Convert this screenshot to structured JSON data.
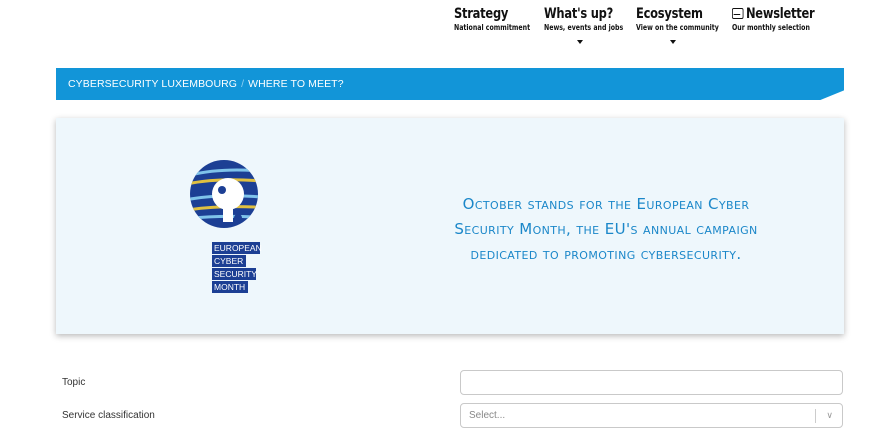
{
  "nav": {
    "items": [
      {
        "title": "Strategy",
        "subtitle": "National commitment"
      },
      {
        "title": "What's up?",
        "subtitle": "News, events and jobs"
      },
      {
        "title": "Ecosystem",
        "subtitle": "View on the community"
      },
      {
        "title": "Newsletter",
        "subtitle": "Our monthly selection"
      }
    ]
  },
  "breadcrumb": {
    "root": "CYBERSECURITY LUXEMBOURG",
    "separator": "/",
    "current": "WHERE TO MEET?"
  },
  "hero": {
    "logo_text": [
      "EUROPEAN",
      "CYBER",
      "SECURITY",
      "MONTH"
    ],
    "line1": "October stands for the European Cyber",
    "line2": "Security Month, the EU's annual campaign",
    "line3": "dedicated to promoting cybersecurity."
  },
  "form": {
    "topic_label": "Topic",
    "topic_value": "",
    "service_label": "Service classification",
    "service_placeholder": "Select..."
  },
  "colors": {
    "brand_blue": "#1295d8",
    "hero_text": "#1b87c9",
    "logo_navy": "#1c3f94"
  }
}
